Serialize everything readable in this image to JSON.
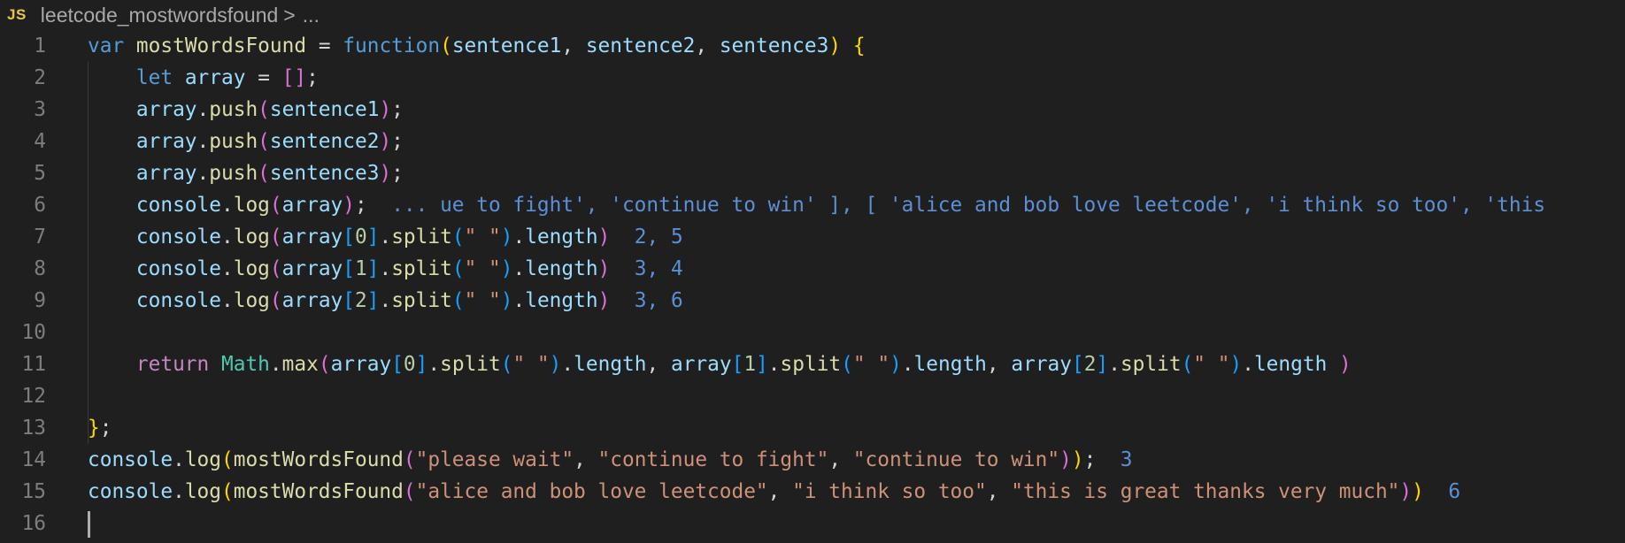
{
  "breadcrumb": {
    "lang_badge": "JS",
    "file_name": "leetcode_mostwordsfound",
    "separator": ">",
    "ellipsis": "..."
  },
  "editor": {
    "line_numbers": [
      "1",
      "2",
      "3",
      "4",
      "5",
      "6",
      "7",
      "8",
      "9",
      "10",
      "11",
      "12",
      "13",
      "14",
      "15",
      "16"
    ],
    "inline_results": {
      "line6": "... ue to fight', 'continue to win' ], [ 'alice and bob love leetcode', 'i think so too', 'this",
      "line7": "2, 5",
      "line8": "3, 4",
      "line9": "3, 6",
      "line14": "3",
      "line15": "6"
    }
  }
}
